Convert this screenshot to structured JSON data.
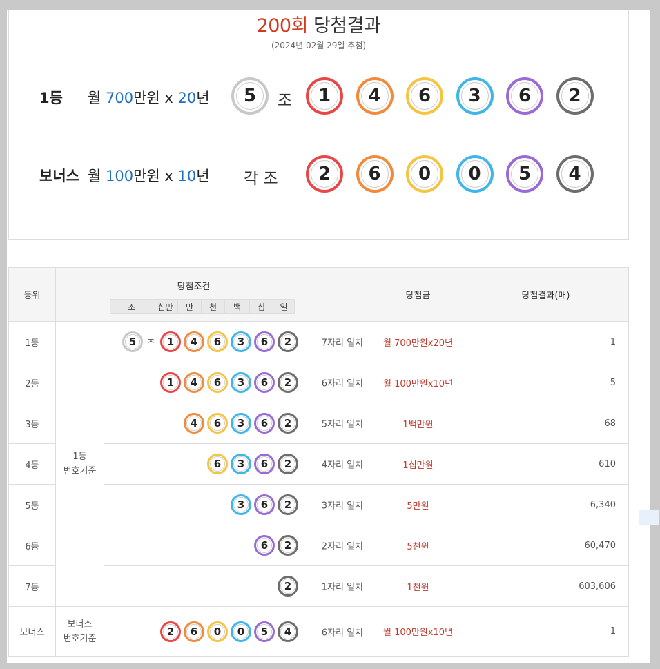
{
  "header": {
    "round": "200회",
    "title_suffix": "당첨결과",
    "date": "(2024년 02월 29일 추첨)"
  },
  "first_prize": {
    "label": "1등",
    "desc_prefix": "월 ",
    "monthly": "700",
    "desc_mid": "만원 x ",
    "years": "20",
    "desc_suffix": "년",
    "group": "5",
    "jo_text": "조",
    "numbers": [
      "1",
      "4",
      "6",
      "3",
      "6",
      "2"
    ]
  },
  "bonus_prize": {
    "label": "보너스",
    "desc_prefix": " 월 ",
    "monthly": "100",
    "desc_mid": "만원 x ",
    "years": "10",
    "desc_suffix": "년",
    "jo_text": "각 조",
    "numbers": [
      "2",
      "6",
      "0",
      "0",
      "5",
      "4"
    ]
  },
  "ball_colors": [
    "#e94747",
    "#f28a3c",
    "#f5c443",
    "#3fb5ea",
    "#9a6bd4",
    "#6d6d6d"
  ],
  "group_ball_color": "#c8c8c8",
  "table": {
    "headers": {
      "rank": "등위",
      "condition": "당첨조건",
      "prize": "당첨금",
      "result": "당첨결과(매)"
    },
    "digit_headers": [
      "조",
      "십만",
      "만",
      "천",
      "백",
      "십",
      "일"
    ],
    "basis_first": "1등\n번호기준",
    "basis_bonus": "보너스\n번호기준",
    "rows": [
      {
        "rank": "1등",
        "match": "7자리 일치",
        "prize": "월 700만원x20년",
        "count": "1"
      },
      {
        "rank": "2등",
        "match": "6자리 일치",
        "prize": "월 100만원x10년",
        "count": "5"
      },
      {
        "rank": "3등",
        "match": "5자리 일치",
        "prize": "1백만원",
        "count": "68"
      },
      {
        "rank": "4등",
        "match": "4자리 일치",
        "prize": "1십만원",
        "count": "610"
      },
      {
        "rank": "5등",
        "match": "3자리 일치",
        "prize": "5만원",
        "count": "6,340"
      },
      {
        "rank": "6등",
        "match": "2자리 일치",
        "prize": "5천원",
        "count": "60,470"
      },
      {
        "rank": "7등",
        "match": "1자리 일치",
        "prize": "1천원",
        "count": "603,606"
      }
    ],
    "bonus_row": {
      "rank": "보너스",
      "match": "6자리 일치",
      "prize": "월 100만원x10년",
      "count": "1"
    },
    "jo_label": "조"
  }
}
